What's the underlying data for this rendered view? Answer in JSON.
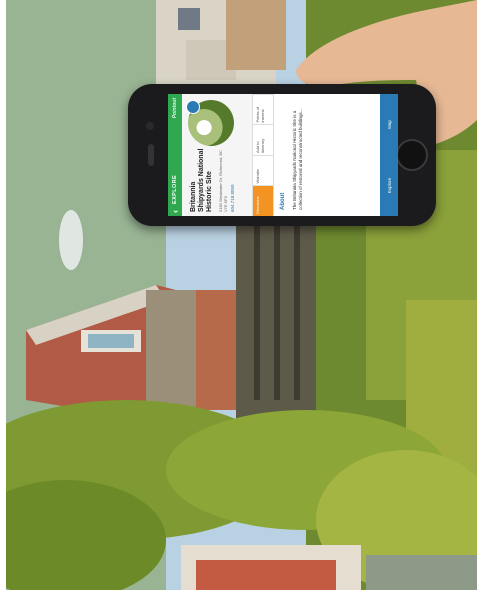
{
  "app": {
    "topbar_label": "EXPLORE",
    "brand": "Pointout",
    "site_title": "Britannia Shipyards National Historic Site",
    "address": "5180 Westwater Dr, Richmond, BC V7E 6P3",
    "phone": "604.718.8050",
    "actions": [
      "Directions",
      "Website",
      "Add to itinerary",
      "Points of interest"
    ],
    "about_heading": "About",
    "about_text": "The Britannia Shipyards National Historic Site is a collection of restored and reconstructed buildings...",
    "bottom_tabs": [
      "Explore",
      "Map"
    ]
  },
  "colors": {
    "topbar": "#2fa84f",
    "accent_orange": "#f39322",
    "accent_blue": "#2a7ab5"
  }
}
